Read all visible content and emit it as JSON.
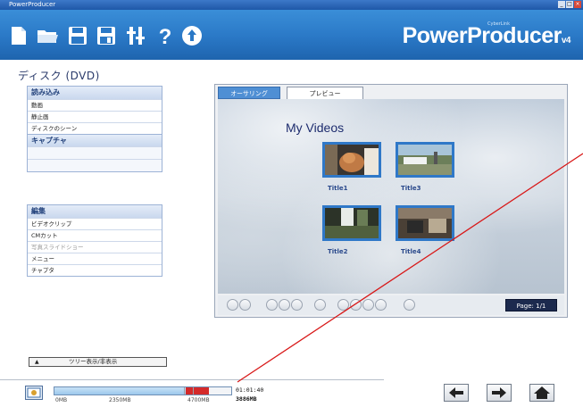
{
  "window": {
    "title": "PowerProducer",
    "min": "_",
    "max": "□",
    "close": "×"
  },
  "brand": {
    "name": "PowerProducer",
    "version": "v4",
    "maker": "CyberLink"
  },
  "toolbar": {
    "icons": [
      "new-project-icon",
      "open-folder-icon",
      "save-icon",
      "save-as-icon",
      "settings-icon",
      "help-icon",
      "info-icon"
    ]
  },
  "disc": {
    "title": "ディスク (DVD)"
  },
  "import_panel": {
    "header": "読み込み",
    "items": [
      "動画",
      "静止画",
      "ディスクのシーン"
    ],
    "capture_header": "キャプチャ"
  },
  "edit_panel": {
    "header": "編集",
    "items": [
      {
        "label": "ビデオクリップ",
        "enabled": true
      },
      {
        "label": "CMカット",
        "enabled": true
      },
      {
        "label": "写真スライドショー",
        "enabled": false
      },
      {
        "label": "メニュー",
        "enabled": true
      },
      {
        "label": "チャプタ",
        "enabled": true
      }
    ]
  },
  "preview": {
    "tabs": [
      "オーサリング",
      "プレビュー"
    ],
    "active_tab": "オーサリング",
    "menu_title": "My Videos",
    "titles": [
      "Title1",
      "Title3",
      "Title2",
      "Title4"
    ],
    "page": "Page: 1/1"
  },
  "tree_toggle": {
    "arrow": "▲",
    "label": "ツリー表示/非表示"
  },
  "status": {
    "capacity_labels": [
      "0MB",
      "2350MB",
      "4700MB"
    ],
    "used_fraction": 0.82,
    "over_fraction": 0.22,
    "duration": "01:01:40",
    "size": "3886MB"
  },
  "colors": {
    "toolbar": "#2a78c6",
    "accent": "#2f78c8",
    "warning": "#d42a2a"
  }
}
